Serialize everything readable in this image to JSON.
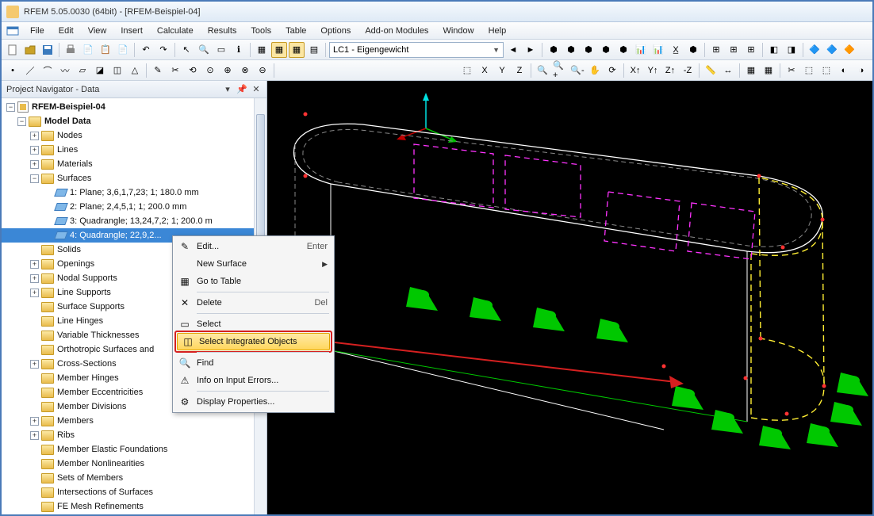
{
  "title": "RFEM 5.05.0030 (64bit) - [RFEM-Beispiel-04]",
  "menu": [
    "File",
    "Edit",
    "View",
    "Insert",
    "Calculate",
    "Results",
    "Tools",
    "Table",
    "Options",
    "Add-on Modules",
    "Window",
    "Help"
  ],
  "loadcase_combo": "LC1 - Eigengewicht",
  "navigator": {
    "title": "Project Navigator - Data",
    "root": "RFEM-Beispiel-04",
    "model_data": "Model Data",
    "nodes": "Nodes",
    "lines": "Lines",
    "materials": "Materials",
    "surfaces": "Surfaces",
    "surf1": "1: Plane; 3,6,1,7,23; 1; 180.0 mm",
    "surf2": "2: Plane; 2,4,5,1; 1; 200.0 mm",
    "surf3": "3: Quadrangle; 13,24,7,2; 1; 200.0 m",
    "surf4": "4: Quadrangle; 22,9,2...",
    "solids": "Solids",
    "openings": "Openings",
    "nodal_supports": "Nodal Supports",
    "line_supports": "Line Supports",
    "surface_supports": "Surface Supports",
    "line_hinges": "Line Hinges",
    "var_thick": "Variable Thicknesses",
    "ortho": "Orthotropic Surfaces and",
    "cross_sections": "Cross-Sections",
    "member_hinges": "Member Hinges",
    "member_ecc": "Member Eccentricities",
    "member_div": "Member Divisions",
    "members": "Members",
    "ribs": "Ribs",
    "member_elastic": "Member Elastic Foundations",
    "member_nonlin": "Member Nonlinearities",
    "sets_members": "Sets of Members",
    "intersections": "Intersections of Surfaces",
    "fe_mesh": "FE Mesh Refinements"
  },
  "context_menu": {
    "edit": "Edit...",
    "edit_sc": "Enter",
    "new_surface": "New Surface",
    "goto_table": "Go to Table",
    "delete": "Delete",
    "delete_sc": "Del",
    "select": "Select",
    "select_integrated": "Select Integrated Objects",
    "find": "Find",
    "info_errors": "Info on Input Errors...",
    "display_props": "Display Properties..."
  }
}
